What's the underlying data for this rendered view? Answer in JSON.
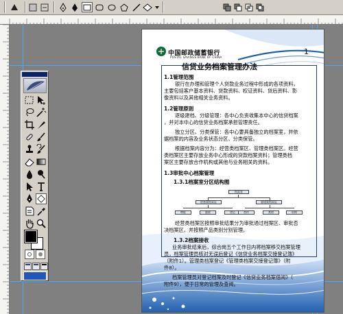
{
  "toolbar": {
    "tools": [
      "path-mode-icon",
      "pen-icon",
      "freeform-pen-icon",
      "rectangle-icon",
      "rounded-rectangle-icon",
      "ellipse-icon",
      "polygon-icon",
      "line-icon",
      "custom-shape-icon",
      "add-anchor-icon",
      "combine-icon"
    ]
  },
  "toolbox": {
    "tools": [
      "marquee-icon",
      "move-icon",
      "lasso-icon",
      "magic-wand-icon",
      "crop-icon",
      "slice-icon",
      "healing-brush-icon",
      "brush-icon",
      "clone-stamp-icon",
      "history-brush-icon",
      "eraser-icon",
      "gradient-icon",
      "blur-icon",
      "dodge-icon",
      "path-select-icon",
      "type-icon",
      "pen-icon",
      "shape-icon",
      "notes-icon",
      "eyedropper-icon",
      "hand-icon",
      "zoom-icon"
    ]
  },
  "colors": {
    "foreground": "#000000",
    "background": "#ffffff",
    "guide": "#4aa6ff",
    "accent_blue": "#1f5fb0"
  },
  "document": {
    "logo_cn": "中国邮政储蓄银行",
    "logo_en": "POSTAL SAVINGS BANK OF CHINA",
    "page_number": "1",
    "title": "信贷业务档案管理办法",
    "s1_heading": "1.1管理范围",
    "s1_lines": [
      "银行在办理和管理个人贷款业务过程中形成的各项资料，",
      "主要包括客户基本资料、贷款资料、权证资料、贷后资料、影",
      "像资料以及其他相关业务资料。"
    ],
    "s2_heading": "1.2管理原则",
    "s2_lines": [
      "逐级建档、分级管理：各中心负责收集本中心的信贷档案",
      "，并对本中心的信贷业务档案承担管理责任。",
      "独立分区、分类保管：各中心要具备独立的档案室，并依",
      "据档案的内容及业务状态分区、分类保管。",
      "根据档案内容分为：经营类档案区、管理类档案区。经营",
      "类档案区主要存放业务中心形成的贷款档案资料；管理类档",
      "案区主要存放合作机构或其他与业务相关的资料。"
    ],
    "s3_heading": "1.3审批中心档案管理",
    "s31_heading": "1.3.1档案室分区结构图",
    "org_top": "档案室",
    "org_mid": [
      "经营类档案区",
      "管理类档案区"
    ],
    "org_bottom": [
      "审批",
      "放款",
      "贷后",
      "合作",
      "其他",
      "机构"
    ],
    "s31_lines": [
      "经营类档案区按照审批结果分为审批通过档案区、审批否",
      "决档案区，并按照产品类别分别管理。"
    ],
    "s32_heading": "1.3.2档案接收",
    "s32_lines": [
      "业务审批结束后，综合岗五个工作日内将档案移交档案管理",
      "员，档案管理员核对无误后登记《信贷业务档案交接登记簿》",
      "（附件1）。管理类档案登记《管理类档案交接登记簿》（附",
      "件8）。",
      "档案管理员对登记档案及时登记《信贷业务档案借阅》（",
      "附件9），便于日常的管理及查阅。"
    ]
  }
}
